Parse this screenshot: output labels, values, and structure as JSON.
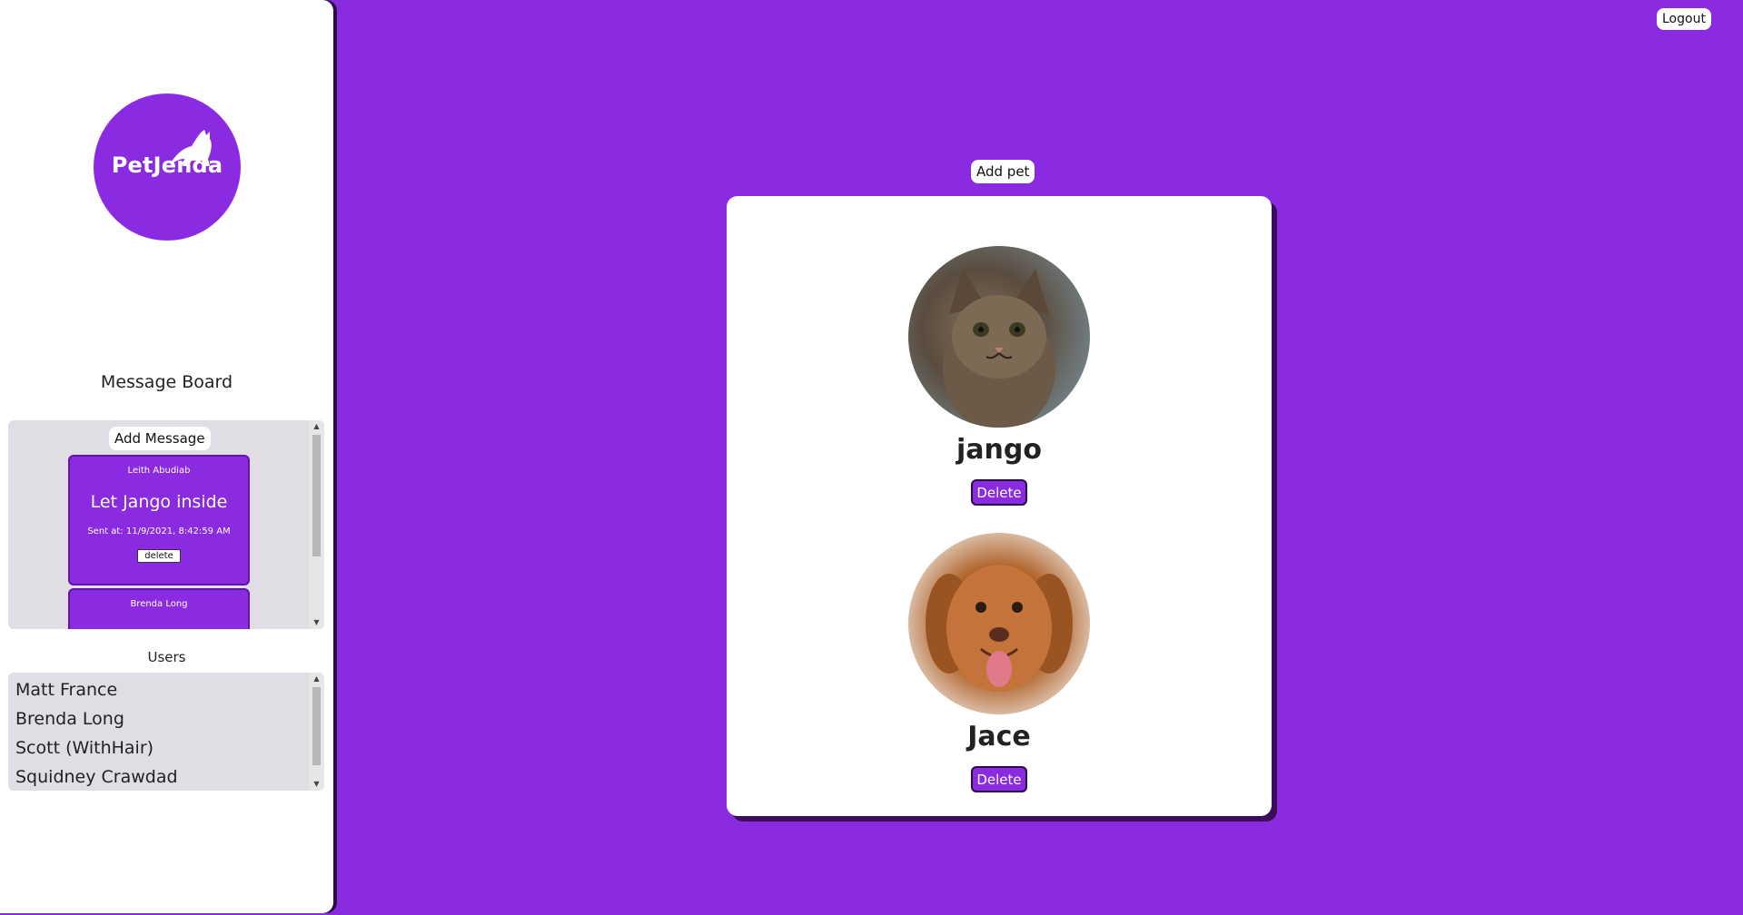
{
  "sidebar": {
    "logo_text": "PetJenda",
    "message_board": {
      "title": "Message Board",
      "add_message_label": "Add Message",
      "messages": [
        {
          "author": "Leith Abudiab",
          "text": "Let Jango inside",
          "sent": "Sent at: 11/9/2021, 8:42:59 AM",
          "delete_label": "delete"
        },
        {
          "author": "Brenda Long"
        }
      ]
    },
    "users": {
      "title": "Users",
      "items": [
        "Matt France",
        "Brenda Long",
        "Scott (WithHair)",
        "Squidney Crawdad"
      ]
    }
  },
  "header": {
    "logout_label": "Logout"
  },
  "main": {
    "add_pet_label": "Add pet",
    "pets": [
      {
        "name": "jango",
        "delete_label": "Delete",
        "photo_icon": "cat-photo"
      },
      {
        "name": "Jace",
        "delete_label": "Delete",
        "photo_icon": "dog-photo"
      }
    ]
  },
  "colors": {
    "accent": "#8a2be2",
    "panel": "#e0dde4",
    "shadow": "#3a0d5c"
  }
}
